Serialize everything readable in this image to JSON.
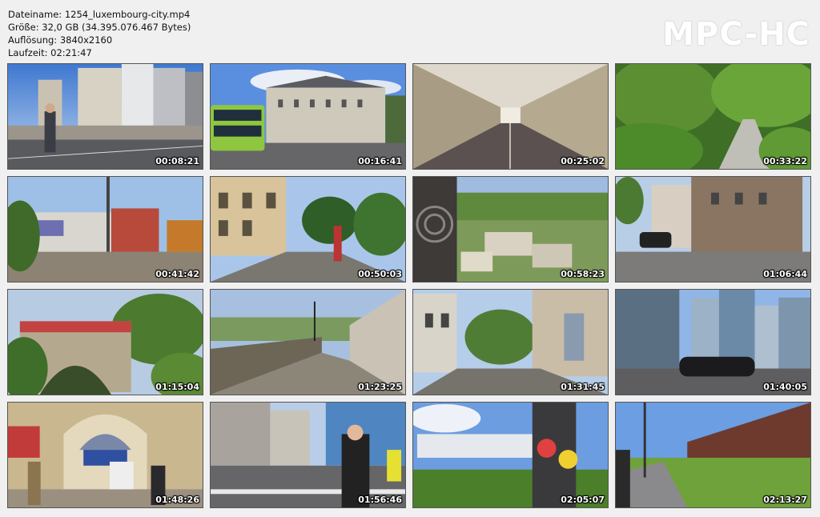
{
  "info": {
    "filename": "Dateiname: 1254_luxembourg-city.mp4",
    "size": "Größe: 32,0 GB (34.395.076.467 Bytes)",
    "resolution": "Auflösung: 3840x2160",
    "duration": "Laufzeit: 02:21:47"
  },
  "logo": "MPC-HC",
  "thumbnails": [
    {
      "time": "00:08:21",
      "scene": "street-city-buildings"
    },
    {
      "time": "00:16:41",
      "scene": "double-decker-bus-palace"
    },
    {
      "time": "00:25:02",
      "scene": "tunnel-walkway"
    },
    {
      "time": "00:33:22",
      "scene": "forest-stream"
    },
    {
      "time": "00:41:42",
      "scene": "construction-graffiti"
    },
    {
      "time": "00:50:03",
      "scene": "old-town-street"
    },
    {
      "time": "00:58:23",
      "scene": "valley-view-grund"
    },
    {
      "time": "01:06:44",
      "scene": "stone-house-street"
    },
    {
      "time": "01:15:04",
      "scene": "stone-bridge"
    },
    {
      "time": "01:23:25",
      "scene": "lane-between-walls"
    },
    {
      "time": "01:31:45",
      "scene": "narrow-street-houses"
    },
    {
      "time": "01:40:05",
      "scene": "modern-glass-buildings-car"
    },
    {
      "time": "01:48:26",
      "scene": "train-station-hall"
    },
    {
      "time": "01:56:46",
      "scene": "pedestrian-crossing-mask"
    },
    {
      "time": "02:05:07",
      "scene": "modern-building-pole"
    },
    {
      "time": "02:13:27",
      "scene": "red-building-grass"
    }
  ]
}
